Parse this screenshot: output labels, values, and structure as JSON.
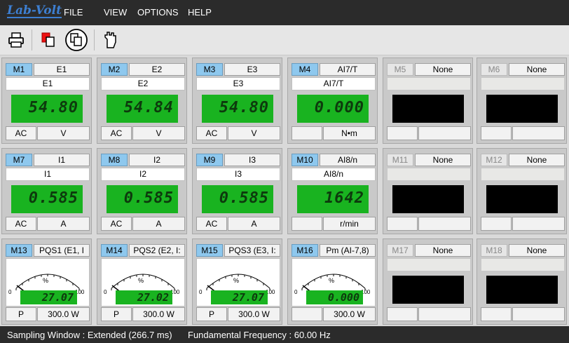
{
  "menubar": {
    "logo": "Lab-Volt",
    "items": [
      "FILE",
      "VIEW",
      "OPTIONS",
      "HELP"
    ]
  },
  "toolbar": {
    "icons": [
      "printer-icon",
      "copy-icon",
      "circular-copy-icon",
      "hand-pointer-icon"
    ]
  },
  "rows": [
    [
      {
        "id": "M1",
        "name": "E1",
        "title": "E1",
        "value": "54.80",
        "left": "AC",
        "right": "V",
        "active": true
      },
      {
        "id": "M2",
        "name": "E2",
        "title": "E2",
        "value": "54.84",
        "left": "AC",
        "right": "V",
        "active": true
      },
      {
        "id": "M3",
        "name": "E3",
        "title": "E3",
        "value": "54.80",
        "left": "AC",
        "right": "V",
        "active": true
      },
      {
        "id": "M4",
        "name": "AI7/T",
        "title": "AI7/T",
        "value": "0.000",
        "left": "",
        "right": "N•m",
        "active": true
      },
      {
        "id": "M5",
        "name": "None",
        "title": "",
        "value": "",
        "left": "",
        "right": "",
        "active": false
      },
      {
        "id": "M6",
        "name": "None",
        "title": "",
        "value": "",
        "left": "",
        "right": "",
        "active": false
      }
    ],
    [
      {
        "id": "M7",
        "name": "I1",
        "title": "I1",
        "value": "0.585",
        "left": "AC",
        "right": "A",
        "active": true
      },
      {
        "id": "M8",
        "name": "I2",
        "title": "I2",
        "value": "0.585",
        "left": "AC",
        "right": "A",
        "active": true
      },
      {
        "id": "M9",
        "name": "I3",
        "title": "I3",
        "value": "0.585",
        "left": "AC",
        "right": "A",
        "active": true
      },
      {
        "id": "M10",
        "name": "AI8/n",
        "title": "AI8/n",
        "value": "1642",
        "left": "",
        "right": "r/min",
        "active": true
      },
      {
        "id": "M11",
        "name": "None",
        "title": "",
        "value": "",
        "left": "",
        "right": "",
        "active": false
      },
      {
        "id": "M12",
        "name": "None",
        "title": "",
        "value": "",
        "left": "",
        "right": "",
        "active": false
      }
    ],
    [
      {
        "id": "M13",
        "name": "PQS1 (E1, I",
        "value": "27.07",
        "left": "P",
        "right": "300.0 W",
        "active": true,
        "analog": true,
        "gauge": {
          "pct": "%",
          "min": "0",
          "max": "100"
        }
      },
      {
        "id": "M14",
        "name": "PQS2 (E2, I:",
        "value": "27.02",
        "left": "P",
        "right": "300.0 W",
        "active": true,
        "analog": true,
        "gauge": {
          "pct": "%",
          "min": "0",
          "max": "100"
        }
      },
      {
        "id": "M15",
        "name": "PQS3 (E3, I:",
        "value": "27.07",
        "left": "P",
        "right": "300.0 W",
        "active": true,
        "analog": true,
        "gauge": {
          "pct": "%",
          "min": "0",
          "max": "100"
        }
      },
      {
        "id": "M16",
        "name": "Pm (AI-7,8)",
        "value": "0.000",
        "left": "",
        "right": "300.0 W",
        "active": true,
        "analog": true,
        "gauge": {
          "pct": "%",
          "min": "0",
          "max": "100"
        }
      },
      {
        "id": "M17",
        "name": "None",
        "title": "",
        "value": "",
        "left": "",
        "right": "",
        "active": false
      },
      {
        "id": "M18",
        "name": "None",
        "title": "",
        "value": "",
        "left": "",
        "right": "",
        "active": false
      }
    ]
  ],
  "status": {
    "sampling": "Sampling Window : Extended (266.7 ms)",
    "frequency": "Fundamental Frequency : 60.00 Hz"
  }
}
